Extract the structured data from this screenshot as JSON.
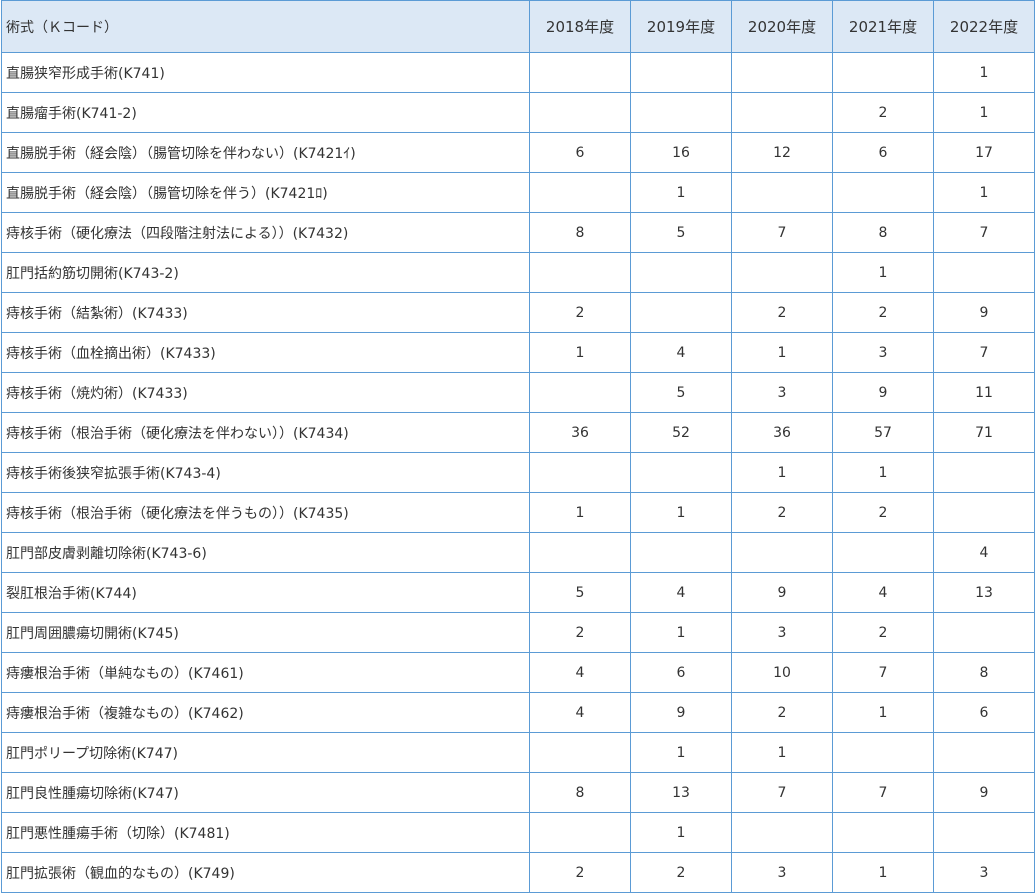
{
  "table": {
    "headers": [
      "術式（Ｋコード）",
      "2018年度",
      "2019年度",
      "2020年度",
      "2021年度",
      "2022年度"
    ],
    "rows": [
      [
        "直腸狭窄形成手術(K741)",
        "",
        "",
        "",
        "",
        "1"
      ],
      [
        "直腸瘤手術(K741-2)",
        "",
        "",
        "",
        "2",
        "1"
      ],
      [
        "直腸脱手術（経会陰）（腸管切除を伴わない）(K7421ｲ)",
        "6",
        "16",
        "12",
        "6",
        "17"
      ],
      [
        "直腸脱手術（経会陰）（腸管切除を伴う）(K7421ﾛ)",
        "",
        "1",
        "",
        "",
        "1"
      ],
      [
        "痔核手術（硬化療法（四段階注射法による））(K7432)",
        "8",
        "5",
        "7",
        "8",
        "7"
      ],
      [
        "肛門括約筋切開術(K743-2)",
        "",
        "",
        "",
        "1",
        ""
      ],
      [
        "痔核手術（結紮術）(K7433)",
        "2",
        "",
        "2",
        "2",
        "9"
      ],
      [
        "痔核手術（血栓摘出術）(K7433)",
        "1",
        "4",
        "1",
        "3",
        "7"
      ],
      [
        "痔核手術（焼灼術）(K7433)",
        "",
        "5",
        "3",
        "9",
        "11"
      ],
      [
        "痔核手術（根治手術（硬化療法を伴わない））(K7434)",
        "36",
        "52",
        "36",
        "57",
        "71"
      ],
      [
        "痔核手術後狭窄拡張手術(K743-4)",
        "",
        "",
        "1",
        "1",
        ""
      ],
      [
        "痔核手術（根治手術（硬化療法を伴うもの））(K7435)",
        "1",
        "1",
        "2",
        "2",
        ""
      ],
      [
        "肛門部皮膚剥離切除術(K743-6)",
        "",
        "",
        "",
        "",
        "4"
      ],
      [
        "裂肛根治手術(K744)",
        "5",
        "4",
        "9",
        "4",
        "13"
      ],
      [
        "肛門周囲膿瘍切開術(K745)",
        "2",
        "1",
        "3",
        "2",
        ""
      ],
      [
        "痔瘻根治手術（単純なもの）(K7461)",
        "4",
        "6",
        "10",
        "7",
        "8"
      ],
      [
        "痔瘻根治手術（複雑なもの）(K7462)",
        "4",
        "9",
        "2",
        "1",
        "6"
      ],
      [
        "肛門ポリープ切除術(K747)",
        "",
        "1",
        "1",
        "",
        ""
      ],
      [
        "肛門良性腫瘍切除術(K747)",
        "8",
        "13",
        "7",
        "7",
        "9"
      ],
      [
        "肛門悪性腫瘍手術（切除）(K7481)",
        "",
        "1",
        "",
        "",
        ""
      ],
      [
        "肛門拡張術（観血的なもの）(K749)",
        "2",
        "2",
        "3",
        "1",
        "3"
      ]
    ]
  }
}
